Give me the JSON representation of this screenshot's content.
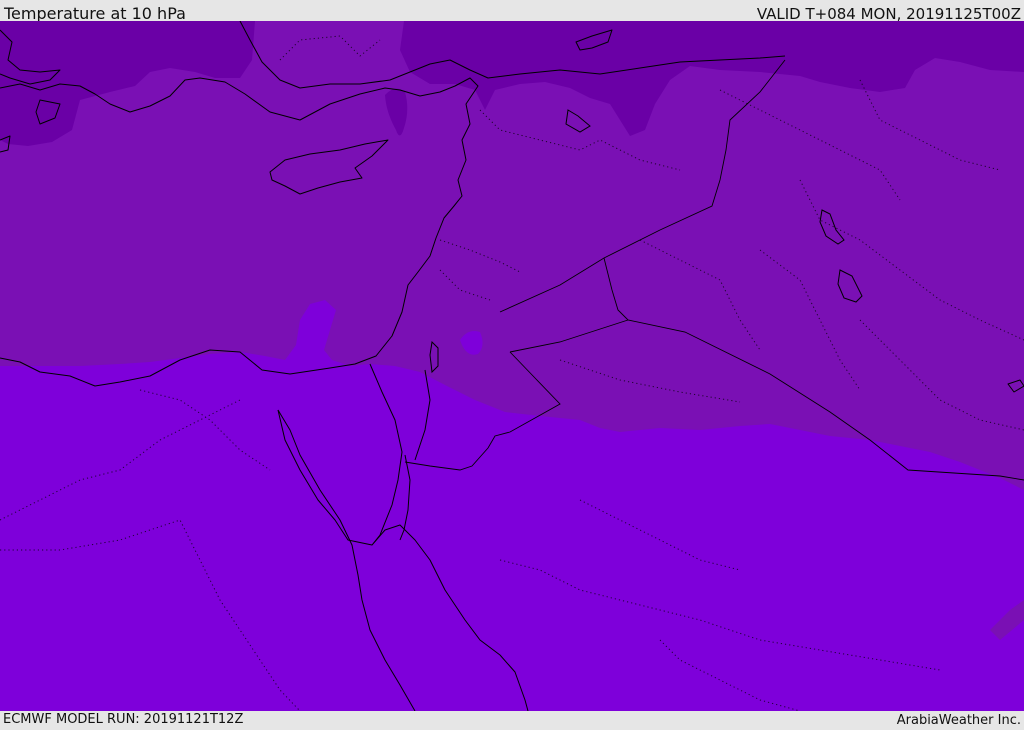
{
  "header": {
    "title": "Temperature at 10 hPa",
    "valid": "VALID T+084 MON, 20191125T00Z"
  },
  "footer": {
    "model_run": "ECMWF MODEL RUN: 20191121T12Z",
    "credit": "ArabiaWeather Inc."
  },
  "colors": {
    "bar_background": "#e6e6e6",
    "level_dark": "#6a00a6",
    "level_mid": "#7a10b4",
    "level_bright": "#7e00da",
    "outline": "#000000"
  }
}
